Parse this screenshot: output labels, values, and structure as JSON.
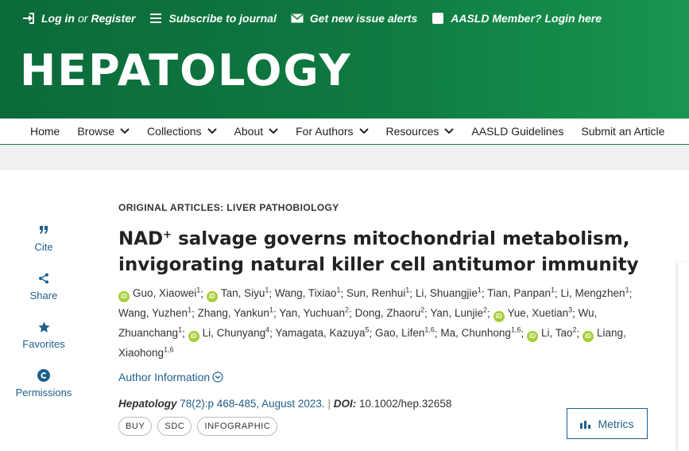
{
  "topbar": {
    "login": "Log in",
    "or": "or",
    "register": "Register",
    "subscribe": "Subscribe to journal",
    "alerts": "Get new issue alerts",
    "member": "AASLD Member? Login here"
  },
  "logo": "HEPATOLOGY",
  "nav": {
    "home": "Home",
    "browse": "Browse",
    "collections": "Collections",
    "about": "About",
    "for_authors": "For Authors",
    "resources": "Resources",
    "guidelines": "AASLD Guidelines",
    "submit": "Submit an Article"
  },
  "rail": {
    "cite": "Cite",
    "share": "Share",
    "favorites": "Favorites",
    "permissions": "Permissions"
  },
  "article": {
    "eyebrow": "ORIGINAL ARTICLES: LIVER PATHOBIOLOGY",
    "title_nad": "NAD",
    "title_sup": "+",
    "title_rest": " salvage governs mitochondrial metabolism, invigorating natural killer cell antitumor immunity",
    "authors": [
      {
        "name": "Guo, Xiaowei",
        "sup": "1",
        "orcid": true
      },
      {
        "name": "Tan, Siyu",
        "sup": "1",
        "orcid": true
      },
      {
        "name": "Wang, Tixiao",
        "sup": "1",
        "orcid": false
      },
      {
        "name": "Sun, Renhui",
        "sup": "1",
        "orcid": false
      },
      {
        "name": "Li, Shuangjie",
        "sup": "1",
        "orcid": false
      },
      {
        "name": "Tian, Panpan",
        "sup": "1",
        "orcid": false
      },
      {
        "name": "Li, Mengzhen",
        "sup": "1",
        "orcid": false
      },
      {
        "name": "Wang, Yuzhen",
        "sup": "1",
        "orcid": false
      },
      {
        "name": "Zhang, Yankun",
        "sup": "1",
        "orcid": false
      },
      {
        "name": "Yan, Yuchuan",
        "sup": "2",
        "orcid": false
      },
      {
        "name": "Dong, Zhaoru",
        "sup": "2",
        "orcid": false
      },
      {
        "name": "Yan, Lunjie",
        "sup": "2",
        "orcid": false
      },
      {
        "name": "Yue, Xuetian",
        "sup": "3",
        "orcid": true
      },
      {
        "name": "Wu, Zhuanchang",
        "sup": "1",
        "orcid": false
      },
      {
        "name": "Li, Chunyang",
        "sup": "4",
        "orcid": true
      },
      {
        "name": "Yamagata, Kazuya",
        "sup": "5",
        "orcid": false
      },
      {
        "name": "Gao, Lifen",
        "sup": "1,6",
        "orcid": false
      },
      {
        "name": "Ma, Chunhong",
        "sup": "1,6",
        "orcid": false
      },
      {
        "name": "Li, Tao",
        "sup": "2",
        "orcid": true
      },
      {
        "name": "Liang, Xiaohong",
        "sup": "1,6",
        "orcid": true
      }
    ],
    "author_info": "Author Information",
    "journal": "Hepatology",
    "volume": "78(2):p 468-485, August 2023.",
    "doi_label": "DOI:",
    "doi": "10.1002/hep.32658"
  },
  "pills": [
    "BUY",
    "SDC",
    "INFOGRAPHIC"
  ],
  "metrics": "Metrics",
  "colors": {
    "brand_green": "#0f7a41",
    "link_blue": "#1f5f8b",
    "orcid_green": "#a6ce39"
  }
}
